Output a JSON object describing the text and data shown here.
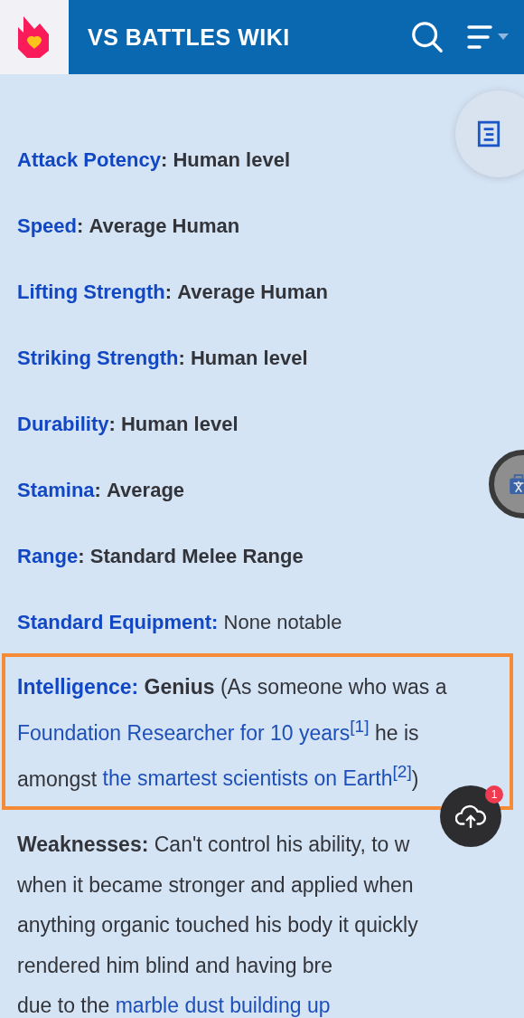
{
  "header": {
    "title": "VS BATTLES WIKI"
  },
  "stats": [
    {
      "label": "Attack Potency",
      "sep": ":",
      "value": "Human level",
      "value_bold": true
    },
    {
      "label": "Speed",
      "sep": ":",
      "value": "Average Human",
      "value_bold": true
    },
    {
      "label": "Lifting Strength",
      "sep": ":",
      "value": "Average Human",
      "value_bold": true
    },
    {
      "label": "Striking Strength",
      "sep": ":",
      "value": "Human level",
      "value_bold": true
    },
    {
      "label": "Durability",
      "sep": ":",
      "value": "Human level",
      "value_bold": true
    },
    {
      "label": "Stamina",
      "sep": ":",
      "value": "Average",
      "value_bold": true
    },
    {
      "label": "Range",
      "sep": ":",
      "value": "Standard Melee Range",
      "value_bold": true
    },
    {
      "label": "Standard Equipment:",
      "value": "None notable",
      "value_bold": false
    }
  ],
  "intelligence": {
    "highlighted": true,
    "lines": [
      [
        {
          "kind": "label",
          "text": "Intelligence:"
        },
        {
          "kind": "bold",
          "text": "Genius"
        },
        {
          "kind": "plain",
          "text": "(As someone who was a"
        }
      ],
      [
        {
          "kind": "link",
          "text": "Foundation Researcher for 10 years$^{[1]}$"
        },
        {
          "kind": "plain",
          "text": "he is"
        }
      ],
      [
        {
          "kind": "plain",
          "text": "amongst"
        },
        {
          "kind": "link",
          "text": "the smartest scientists on Earth$^{[2]}$"
        },
        {
          "kind": "tight",
          "text": ")"
        }
      ]
    ]
  },
  "weaknesses": {
    "lines": [
      [
        {
          "kind": "bold",
          "text": "Weaknesses:"
        },
        {
          "kind": "plain",
          "text": "Can't control his ability, to w"
        }
      ],
      [
        {
          "kind": "plain",
          "text": "when it became stronger and applied when"
        }
      ],
      [
        {
          "kind": "plain",
          "text": "anything organic touched his body it quickly"
        }
      ],
      [
        {
          "kind": "plain",
          "text": "rendered him blind and having bre"
        }
      ],
      [
        {
          "kind": "plain",
          "text": "due to the"
        },
        {
          "kind": "link",
          "text": "marble dust building up"
        }
      ]
    ]
  },
  "upload_badge": "1"
}
